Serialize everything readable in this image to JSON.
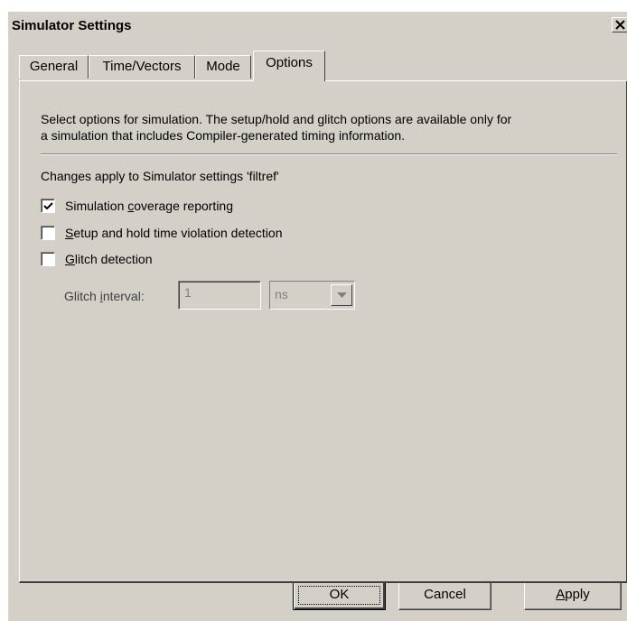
{
  "window": {
    "title": "Simulator Settings"
  },
  "tabs": [
    {
      "label": "General",
      "active": false
    },
    {
      "label": "Time/Vectors",
      "active": false
    },
    {
      "label": "Mode",
      "active": false
    },
    {
      "label": "Options",
      "active": true
    }
  ],
  "options": {
    "description_line1": "Select options for simulation.  The setup/hold and glitch options are available only for",
    "description_line2": "a simulation that includes Compiler-generated timing information.",
    "changes_text": "Changes apply to Simulator settings 'filtref'",
    "coverage": {
      "label_pre": "Simulation ",
      "label_acc": "c",
      "label_post": "overage reporting",
      "checked": true
    },
    "setup_hold": {
      "label_pre": "",
      "label_acc": "S",
      "label_post": "etup and hold time violation detection",
      "checked": false
    },
    "glitch": {
      "label_pre": "",
      "label_acc": "G",
      "label_post": "litch detection",
      "checked": false
    },
    "glitch_interval": {
      "label_pre": "Glitch ",
      "label_acc": "i",
      "label_post": "nterval:",
      "value": "1",
      "unit": "ns"
    }
  },
  "buttons": {
    "ok": "OK",
    "cancel": "Cancel",
    "apply_acc": "A",
    "apply_rest": "pply"
  },
  "icons": {
    "close": "close-icon",
    "check": "checkmark-icon",
    "dropdown": "chevron-down-icon"
  }
}
